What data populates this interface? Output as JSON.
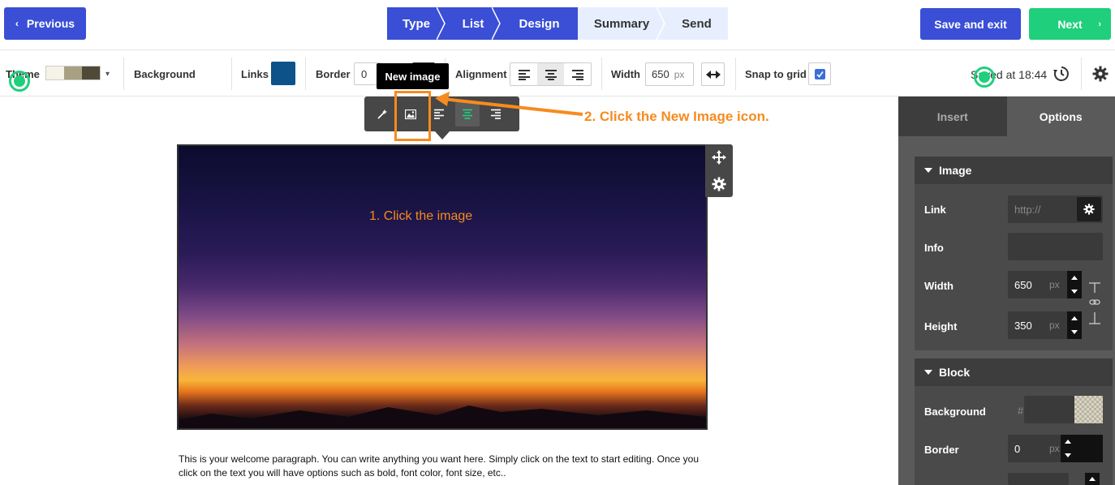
{
  "header": {
    "previous_label": "Previous",
    "steps": [
      {
        "label": "Type",
        "state": "active"
      },
      {
        "label": "List",
        "state": "active"
      },
      {
        "label": "Design",
        "state": "active"
      },
      {
        "label": "Summary",
        "state": "inactive"
      },
      {
        "label": "Send",
        "state": "inactive"
      }
    ],
    "save_label": "Save and exit",
    "next_label": "Next"
  },
  "toolbar": {
    "theme_label": "Theme",
    "theme_colors": [
      "#f5f3e6",
      "#a9a084",
      "#4f4a38"
    ],
    "background_label": "Background",
    "links_label": "Links",
    "links_color": "#0d5289",
    "border_label": "Border",
    "border_value": "0",
    "alignment_label": "Alignment",
    "width_label": "Width",
    "width_value": "650",
    "width_unit": "px",
    "snap_label": "Snap to grid",
    "snap_checked": true,
    "saved_text": "Saved at 18:44"
  },
  "tooltip": {
    "text": "New image"
  },
  "image_toolbar": {
    "icons": [
      "magic-wand-icon",
      "new-image-icon",
      "align-left-icon",
      "align-center-icon",
      "align-right-icon"
    ]
  },
  "annotations": {
    "step1": "1. Click the image",
    "step2": "2. Click the New Image icon."
  },
  "content": {
    "paragraph": "This is your welcome paragraph. You can write anything you want here. Simply click on the text to start editing. Once you click on the text you will have options such as bold, font color, font size, etc.."
  },
  "sidebar": {
    "tabs": [
      {
        "label": "Insert",
        "state": "inactive"
      },
      {
        "label": "Options",
        "state": "active"
      }
    ],
    "image_panel": {
      "title": "Image",
      "link_label": "Link",
      "link_placeholder": "http://",
      "info_label": "Info",
      "width_label": "Width",
      "width_value": "650",
      "height_label": "Height",
      "height_value": "350",
      "unit": "px"
    },
    "block_panel": {
      "title": "Block",
      "background_label": "Background",
      "hash": "#",
      "border_label": "Border",
      "border_value": "0",
      "unit": "px"
    }
  },
  "colors": {
    "primary": "#3a4fd5",
    "success": "#1fcf7b",
    "annotation": "#f68b1f"
  }
}
